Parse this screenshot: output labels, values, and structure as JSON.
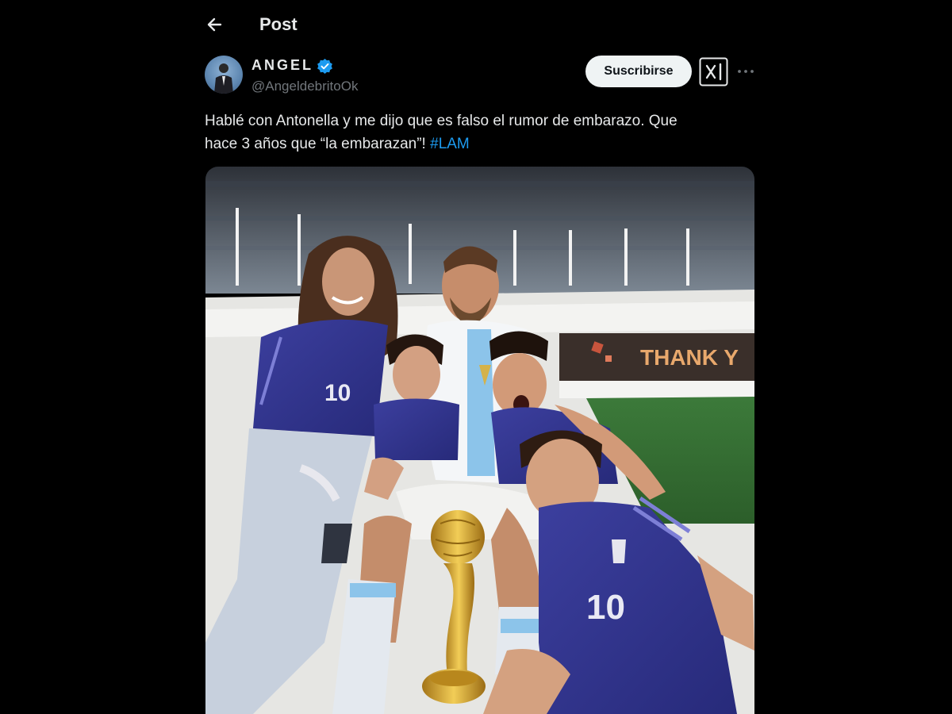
{
  "header": {
    "title": "Post",
    "back_icon": "arrow-left-icon"
  },
  "author": {
    "name": "ANGEL",
    "handle": "@AngeldebritoOk",
    "verified": true,
    "verified_color": "#1d9bf0"
  },
  "actions": {
    "subscribe_label": "Suscribirse",
    "grok_icon": "grok-icon",
    "more_icon": "more-icon"
  },
  "post": {
    "text_line1": "Hablé con Antonella y me dijo que es falso el rumor de embarazo. Que",
    "text_line2": "hace 3 años que “la embarazan”! ",
    "hashtag": "#LAM",
    "hashtag_color": "#1d9bf0"
  },
  "media": {
    "banner_text": "THANK Y"
  },
  "colors": {
    "background": "#000000",
    "text": "#e7e9ea",
    "secondary_text": "#71767b",
    "button_bg": "#eff3f4"
  }
}
